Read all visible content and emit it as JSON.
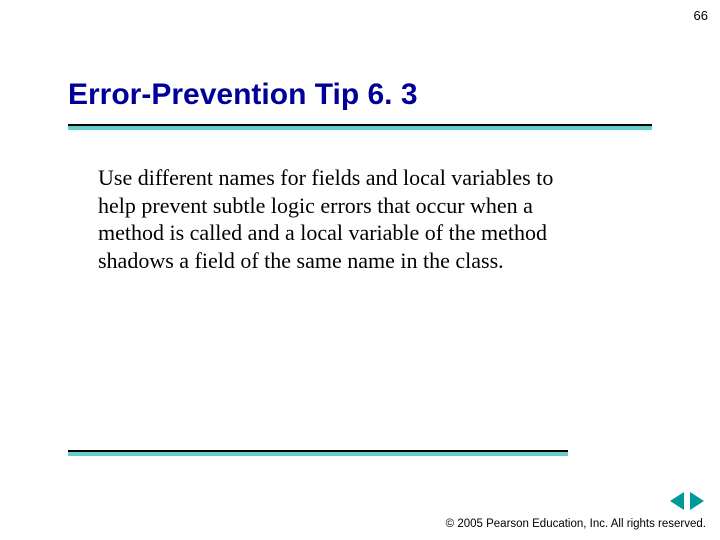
{
  "page_number": "66",
  "title": "Error-Prevention Tip 6. 3",
  "body": "Use different names for fields and local variables to help prevent subtle logic errors that occur when a method is called and a local variable of the method shadows a field of the same name in the class.",
  "copyright": "© 2005 Pearson Education, Inc.  All rights reserved.",
  "nav": {
    "prev": "previous",
    "next": "next"
  }
}
